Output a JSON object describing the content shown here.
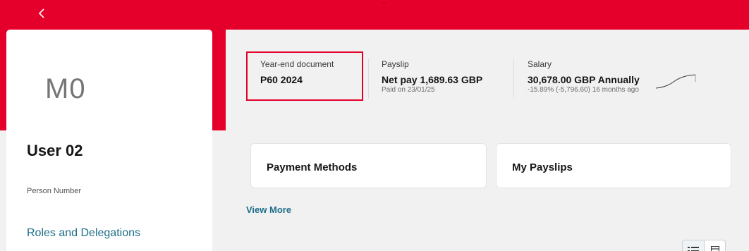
{
  "profile": {
    "initials": "M0",
    "name": "User 02",
    "person_number_label": "Person Number",
    "roles_link": "Roles and Delegations"
  },
  "metrics": {
    "year_end": {
      "label": "Year-end document",
      "value": "P60 2024"
    },
    "payslip": {
      "label": "Payslip",
      "value": "Net pay 1,689.63 GBP",
      "sub": "Paid on 23/01/25"
    },
    "salary": {
      "label": "Salary",
      "value": "30,678.00 GBP Annually",
      "sub": "-15.89% (-5,796.60) 16 months ago"
    }
  },
  "tiles": [
    {
      "title": "Payment Methods"
    },
    {
      "title": "My Payslips"
    }
  ],
  "view_more": "View More",
  "icons": {
    "back": "chevron-left-icon",
    "trend": "sparkline-trend-icon",
    "list_view": "list-view-icon",
    "card_view": "card-view-icon"
  },
  "colors": {
    "brand": "#e4002b",
    "link": "#1d6e8a",
    "highlight": "#e4002b"
  }
}
